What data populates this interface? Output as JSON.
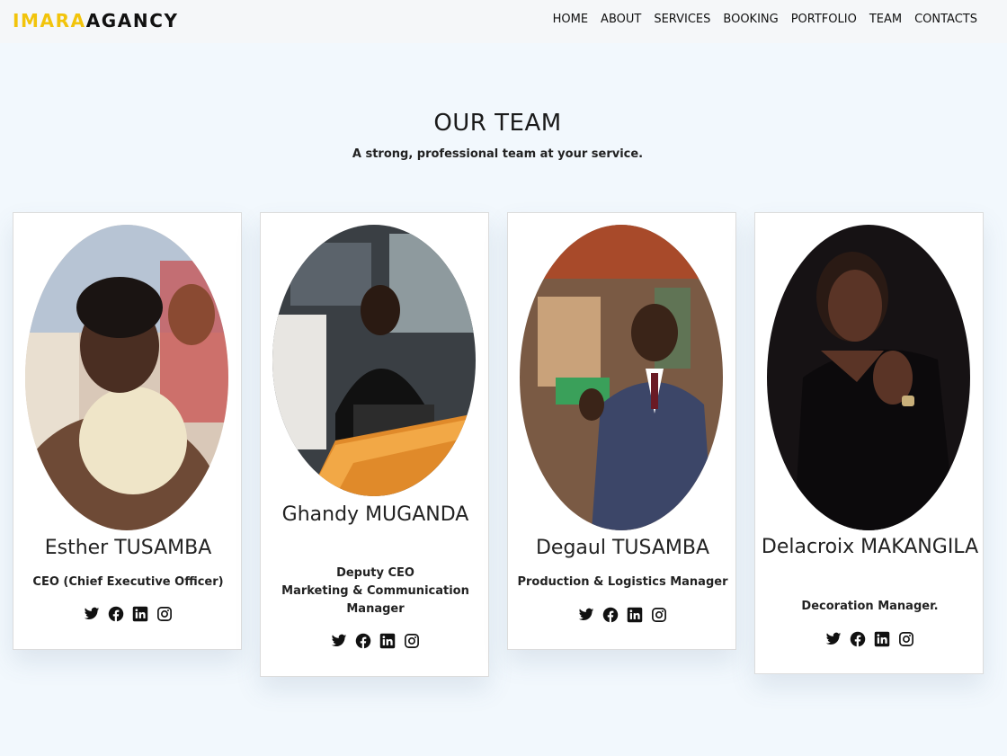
{
  "header": {
    "logo_part1": "IMARA",
    "logo_part2": "AGANCY",
    "nav": [
      "HOME",
      "ABOUT",
      "SERVICES",
      "BOOKING",
      "PORTFOLIO",
      "TEAM",
      "CONTACTS"
    ]
  },
  "team": {
    "title": "OUR TEAM",
    "subtitle": "A strong, professional team at your service.",
    "members": [
      {
        "name": "Esther TUSAMBA",
        "role": [
          "CEO (Chief Executive Officer)"
        ]
      },
      {
        "name": "Ghandy MUGANDA",
        "role": [
          "Deputy CEO",
          "Marketing & Communication Manager"
        ]
      },
      {
        "name": "Degaul TUSAMBA",
        "role": [
          "Production & Logistics Manager"
        ]
      },
      {
        "name": "Delacroix MAKANGILA",
        "role": [
          "Decoration Manager."
        ]
      }
    ]
  },
  "social_icons": [
    "twitter-icon",
    "facebook-icon",
    "linkedin-icon",
    "instagram-icon"
  ],
  "colors": {
    "page_background": "#f2f8fd",
    "header_background": "#f5f7f9",
    "logo_accent": "#f2c40c",
    "card_background": "#ffffff",
    "text": "#111111"
  }
}
